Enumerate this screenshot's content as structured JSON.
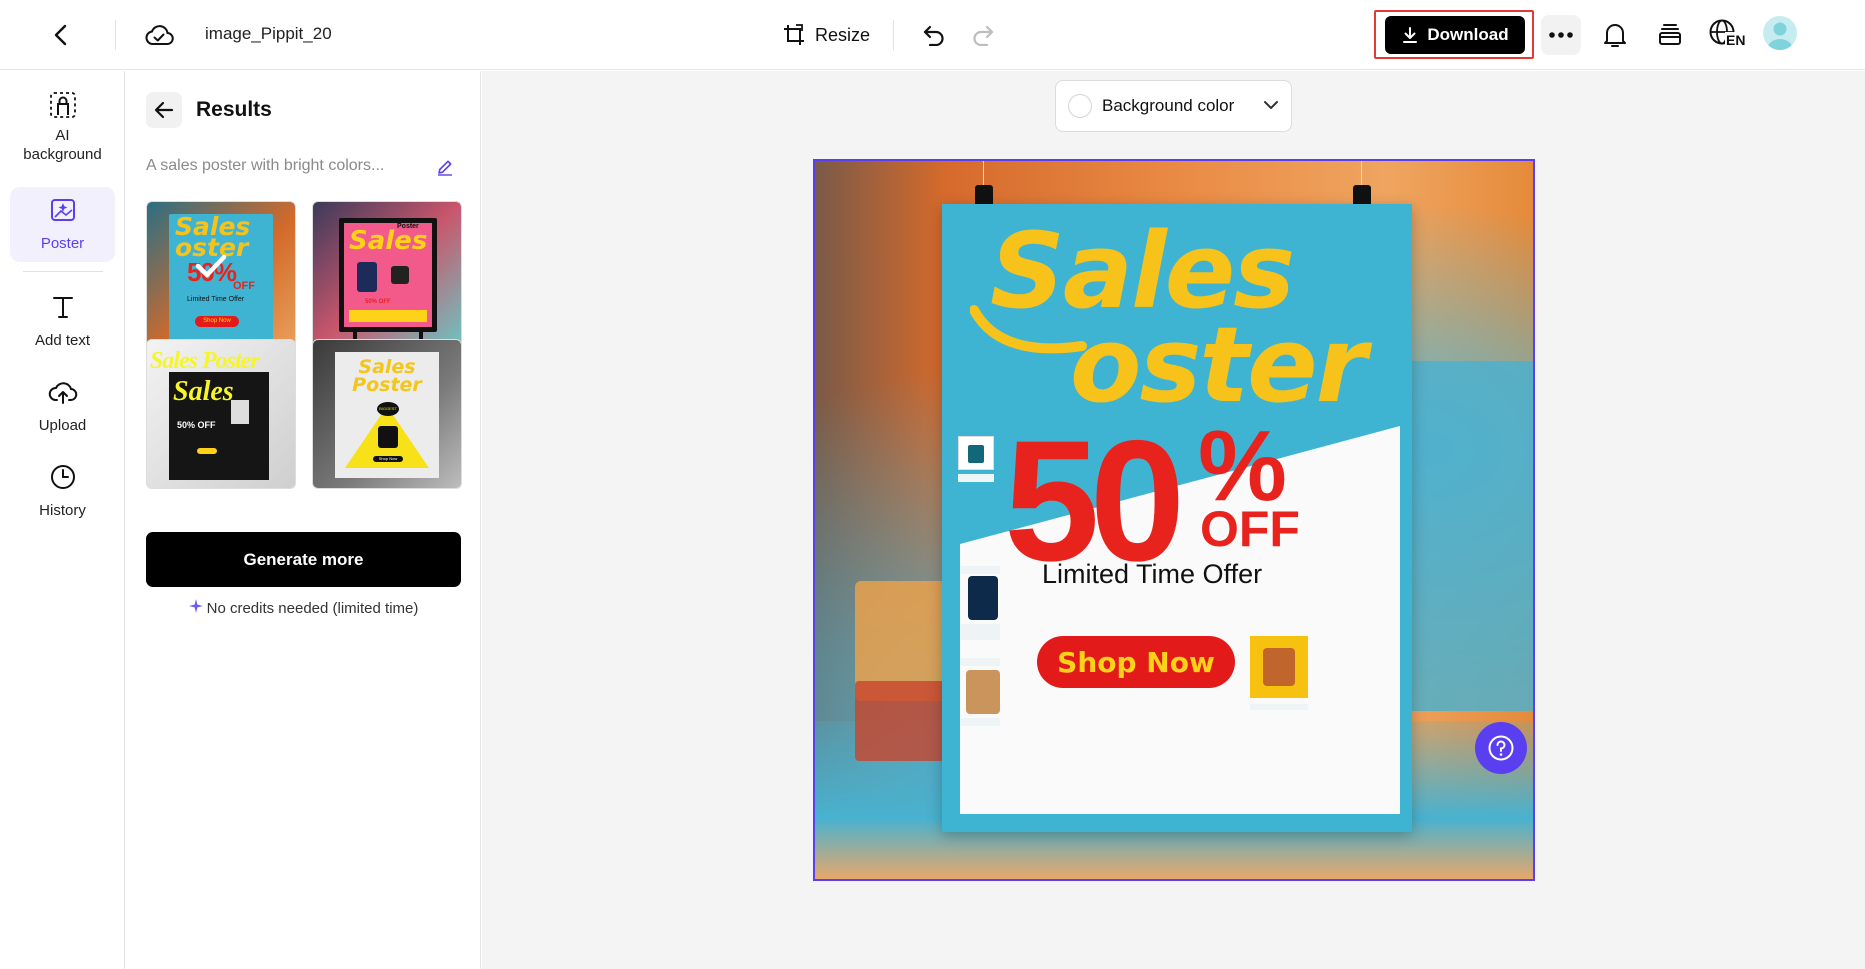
{
  "header": {
    "file_name": "image_Pippit_20",
    "resize_label": "Resize",
    "download_label": "Download",
    "language_badge": "EN",
    "icons": {
      "back": "chevron-left-icon",
      "cloud_sync": "cloud-check-icon",
      "resize": "resize-icon",
      "undo": "undo-icon",
      "redo": "redo-icon",
      "download": "download-arrow-icon",
      "more": "more-dots-icon",
      "notifications": "bell-icon",
      "layers": "stack-icon",
      "language": "globe-icon",
      "avatar": "user-avatar-icon"
    },
    "accent_color": "#000000",
    "highlight_border_color": "#e53935"
  },
  "left_rail": {
    "items": [
      {
        "label": "AI background",
        "icon": "ai-background-icon"
      },
      {
        "label": "Poster",
        "icon": "poster-sparkle-icon",
        "active": true
      },
      {
        "label": "Add text",
        "icon": "text-t-icon"
      },
      {
        "label": "Upload",
        "icon": "upload-cloud-icon"
      },
      {
        "label": "History",
        "icon": "clock-icon"
      }
    ],
    "active_color": "#5a3ff0"
  },
  "results_panel": {
    "title": "Results",
    "prompt_text": "A sales poster with bright colors...",
    "thumbnails": [
      {
        "title_line1": "Sales",
        "title_line2": "oster",
        "discount": "50%",
        "off": "OFF",
        "sub": "Limited Time Offer",
        "cta": "Shop Now",
        "selected": true
      },
      {
        "title_line1": "Sales",
        "title_line2": "Poster",
        "discount": "50% OFF"
      },
      {
        "title_line1": "Sales Poster",
        "title_line2": "Sales",
        "discount": "50% OFF"
      },
      {
        "title_line1": "Sales",
        "title_line2": "Poster",
        "badge": "BIGGEST",
        "cta": "Shop Now"
      }
    ],
    "generate_more_label": "Generate more",
    "credits_note": "No credits needed (limited time)"
  },
  "canvas": {
    "background_color_label": "Background color",
    "frame_color": "#5a3ff0",
    "poster": {
      "title_line1": "Sales",
      "title_line2": "oster",
      "discount_number": "50",
      "discount_percent": "%",
      "discount_off": "OFF",
      "subtitle": "Limited Time Offer",
      "cta": "Shop Now",
      "colors": {
        "board": "#3fb4d2",
        "title": "#f7c21a",
        "discount": "#e8231e",
        "cta_bg": "#e31a1a",
        "cta_text": "#ffd21a",
        "bag_tile": "#f6c20f"
      }
    }
  },
  "help_button": {
    "icon": "question-circle-icon",
    "color": "#5a3ff0"
  }
}
